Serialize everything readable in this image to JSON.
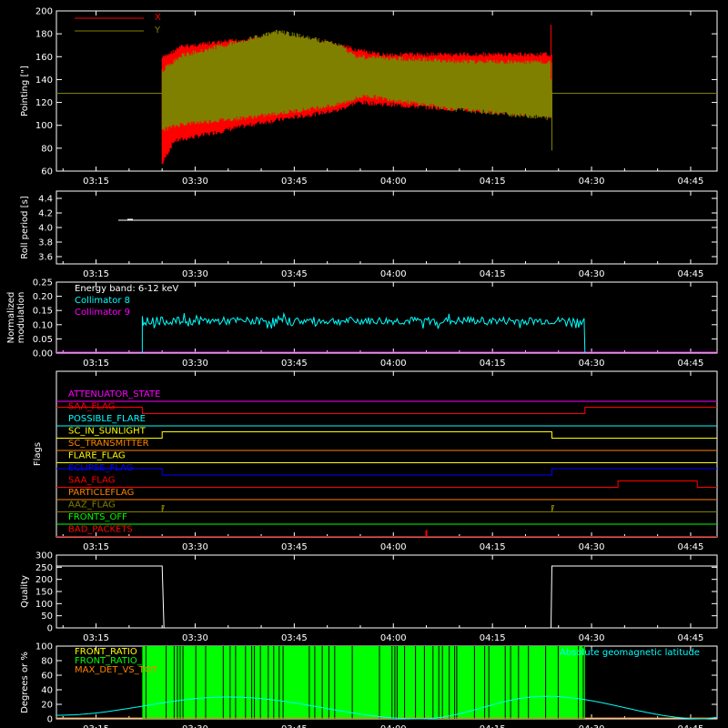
{
  "colors": {
    "background": "#000000",
    "axes": "#ffffff",
    "x": "#ff0000",
    "y": "#808000",
    "cyan": "#00ffff",
    "magenta": "#ff00ff",
    "green": "#00ff00",
    "orange": "#ff8000",
    "yellow": "#ffff00",
    "blue": "#0000ff",
    "red": "#ff0000"
  },
  "time_ticks": [
    "03:15",
    "03:30",
    "03:45",
    "04:00",
    "04:15",
    "04:30",
    "04:45"
  ],
  "chart_data": [
    {
      "type": "line",
      "ylabel": "Pointing [\"]",
      "ylim": [
        60,
        200
      ],
      "yticks": [
        60,
        80,
        100,
        120,
        140,
        160,
        180,
        200
      ],
      "legend": {
        "x_label": "X",
        "y_label": "Y",
        "placement": "top-left"
      },
      "series": [
        {
          "name": "X",
          "color_key": "x",
          "start": "03:25",
          "end": "04:24",
          "pre_value": 128,
          "upper": [
            [
              0,
              161
            ],
            [
              0.05,
              171
            ],
            [
              0.3,
              180
            ],
            [
              0.45,
              172
            ],
            [
              0.55,
              164
            ],
            [
              1,
              164
            ]
          ],
          "lower": [
            [
              0,
              64
            ],
            [
              0.03,
              84
            ],
            [
              0.25,
              100
            ],
            [
              0.45,
              111
            ],
            [
              0.5,
              118
            ],
            [
              0.75,
              112
            ],
            [
              1,
              106
            ]
          ]
        },
        {
          "name": "Y",
          "color_key": "y",
          "start": "03:25",
          "end": "04:24",
          "pre_value": 128,
          "upper": [
            [
              0,
              150
            ],
            [
              0.05,
              163
            ],
            [
              0.3,
              184
            ],
            [
              0.45,
              173
            ],
            [
              0.5,
              162
            ],
            [
              0.75,
              158
            ],
            [
              1,
              157
            ]
          ],
          "lower": [
            [
              0,
              94
            ],
            [
              0.05,
              99
            ],
            [
              0.25,
              106
            ],
            [
              0.45,
              116
            ],
            [
              0.52,
              124
            ],
            [
              0.75,
              112
            ],
            [
              1,
              104
            ]
          ]
        }
      ]
    },
    {
      "type": "line",
      "ylabel": "Roll period [s]",
      "ylim": [
        3.5,
        4.5
      ],
      "yticks": [
        3.6,
        3.8,
        4.0,
        4.2,
        4.4
      ],
      "series": [
        {
          "color_key": "axes",
          "value": 4.1
        }
      ]
    },
    {
      "type": "line",
      "ylabel": "Normalized modulation",
      "ylim": [
        0,
        0.25
      ],
      "yticks": [
        0.0,
        0.05,
        0.1,
        0.15,
        0.2,
        0.25
      ],
      "legend": {
        "title": "Energy band: 6-12 keV",
        "entries": [
          "Collimator 8",
          "Collimator 9"
        ],
        "placement": "top-left"
      },
      "series": [
        {
          "name": "Collimator 8",
          "color_key": "cyan",
          "start": "03:22",
          "end": "04:29",
          "mean": 0.113,
          "spread": 0.014
        },
        {
          "name": "Collimator 9",
          "color_key": "magenta",
          "value": 0.0
        }
      ]
    },
    {
      "type": "line",
      "ylabel": "Flags",
      "flags": [
        {
          "label": "ATTENUATOR_STATE",
          "color_key": "magenta",
          "segments": [
            [
              "03:09",
              "04:49",
              0
            ]
          ]
        },
        {
          "label": "SAA_FLAG",
          "color_key": "red",
          "segments": [
            [
              "03:09",
              "03:22",
              1
            ],
            [
              "03:22",
              "04:29",
              0
            ],
            [
              "04:29",
              "04:49",
              1
            ]
          ]
        },
        {
          "label": "POSSIBLE_FLARE",
          "color_key": "cyan",
          "segments": [
            [
              "03:09",
              "04:49",
              0
            ]
          ]
        },
        {
          "label": "SC_IN_SUNLIGHT",
          "color_key": "yellow",
          "segments": [
            [
              "03:09",
              "03:25",
              0
            ],
            [
              "03:25",
              "04:24",
              1
            ],
            [
              "04:24",
              "04:49",
              0
            ]
          ]
        },
        {
          "label": "SC_TRANSMITTER",
          "color_key": "orange",
          "segments": [
            [
              "03:09",
              "04:49",
              0
            ]
          ]
        },
        {
          "label": "FLARE_FLAG",
          "color_key": "yellow",
          "segments": [
            [
              "03:09",
              "04:49",
              0
            ]
          ]
        },
        {
          "label": "ECLIPSE_FLAG",
          "color_key": "blue",
          "segments": [
            [
              "03:09",
              "03:25",
              1
            ],
            [
              "03:25",
              "04:24",
              0
            ],
            [
              "04:24",
              "04:49",
              1
            ]
          ]
        },
        {
          "label": "SAA_FLAG",
          "color_key": "red",
          "segments": [
            [
              "03:09",
              "04:34",
              0
            ],
            [
              "04:34",
              "04:46",
              1
            ],
            [
              "04:46",
              "04:49",
              0
            ]
          ]
        },
        {
          "label": "PARTICLEFLAG",
          "color_key": "orange",
          "segments": [
            [
              "03:09",
              "04:49",
              0
            ]
          ]
        },
        {
          "label": "AAZ_FLAG",
          "color_key": "y",
          "segments": [
            [
              "03:09",
              "03:25",
              0
            ],
            [
              "03:25",
              "03:25",
              1
            ],
            [
              "03:25",
              "04:24",
              0
            ],
            [
              "04:24",
              "04:24",
              1
            ],
            [
              "04:24",
              "04:49",
              0
            ]
          ]
        },
        {
          "label": "FRONTS_OFF",
          "color_key": "green",
          "segments": [
            [
              "03:09",
              "04:49",
              0
            ]
          ]
        },
        {
          "label": "BAD_PACKETS",
          "color_key": "red",
          "segments": [
            [
              "03:09",
              "04:49",
              0
            ]
          ],
          "spikes": [
            "04:05"
          ]
        }
      ]
    },
    {
      "type": "line",
      "ylabel": "Quality",
      "ylim": [
        0,
        300
      ],
      "yticks": [
        0,
        50,
        100,
        150,
        200,
        250,
        300
      ],
      "series": [
        {
          "color_key": "axes",
          "points": [
            [
              "03:09",
              255
            ],
            [
              "03:25",
              255
            ],
            [
              "03:25",
              0
            ],
            [
              "04:24",
              0
            ],
            [
              "04:24",
              255
            ],
            [
              "04:49",
              255
            ]
          ]
        }
      ]
    },
    {
      "type": "line",
      "ylabel": "Degrees or %",
      "ylim": [
        0,
        100
      ],
      "yticks": [
        0,
        20,
        40,
        60,
        80,
        100
      ],
      "legend": {
        "entries": [
          "FRONT_RATIO",
          "FRONT_RATIO_",
          "MAX_DET_VS_TOT"
        ],
        "right_label": "Absolute geomagnetic latitude",
        "placement": "top"
      },
      "series": [
        {
          "name": "FRONT_RATIO",
          "color_key": "green",
          "start": "03:22",
          "end": "04:29",
          "value": 100
        },
        {
          "name": "Absolute geomagnetic latitude",
          "color_key": "cyan",
          "points": [
            [
              "03:09",
              5
            ],
            [
              "03:35",
              30
            ],
            [
              "04:04",
              0
            ],
            [
              "04:23",
              31
            ],
            [
              "04:47",
              0
            ],
            [
              "04:49",
              2
            ]
          ]
        }
      ]
    }
  ]
}
